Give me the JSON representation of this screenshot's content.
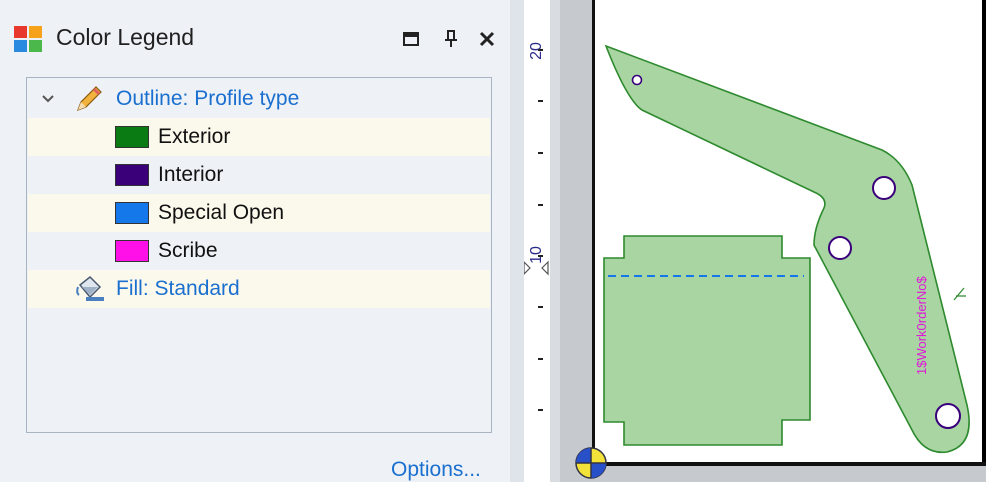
{
  "panel": {
    "title": "Color Legend",
    "options_label": "Options..."
  },
  "legend": {
    "outline_group": "Outline: Profile type",
    "items": [
      {
        "label": "Exterior",
        "color": "#0a7a12"
      },
      {
        "label": "Interior",
        "color": "#3a007a"
      },
      {
        "label": "Special Open",
        "color": "#1478ea"
      },
      {
        "label": "Scribe",
        "color": "#ff10e8"
      }
    ],
    "fill_group": "Fill: Standard"
  },
  "ruler": {
    "tick_20": "20",
    "tick_10": "10"
  },
  "drawing": {
    "part_fill": "#a8d5a2",
    "part_stroke": "#2e8a2e",
    "scribe_text": "1$Work0rderNo$",
    "scribe_color": "#e018d8"
  }
}
